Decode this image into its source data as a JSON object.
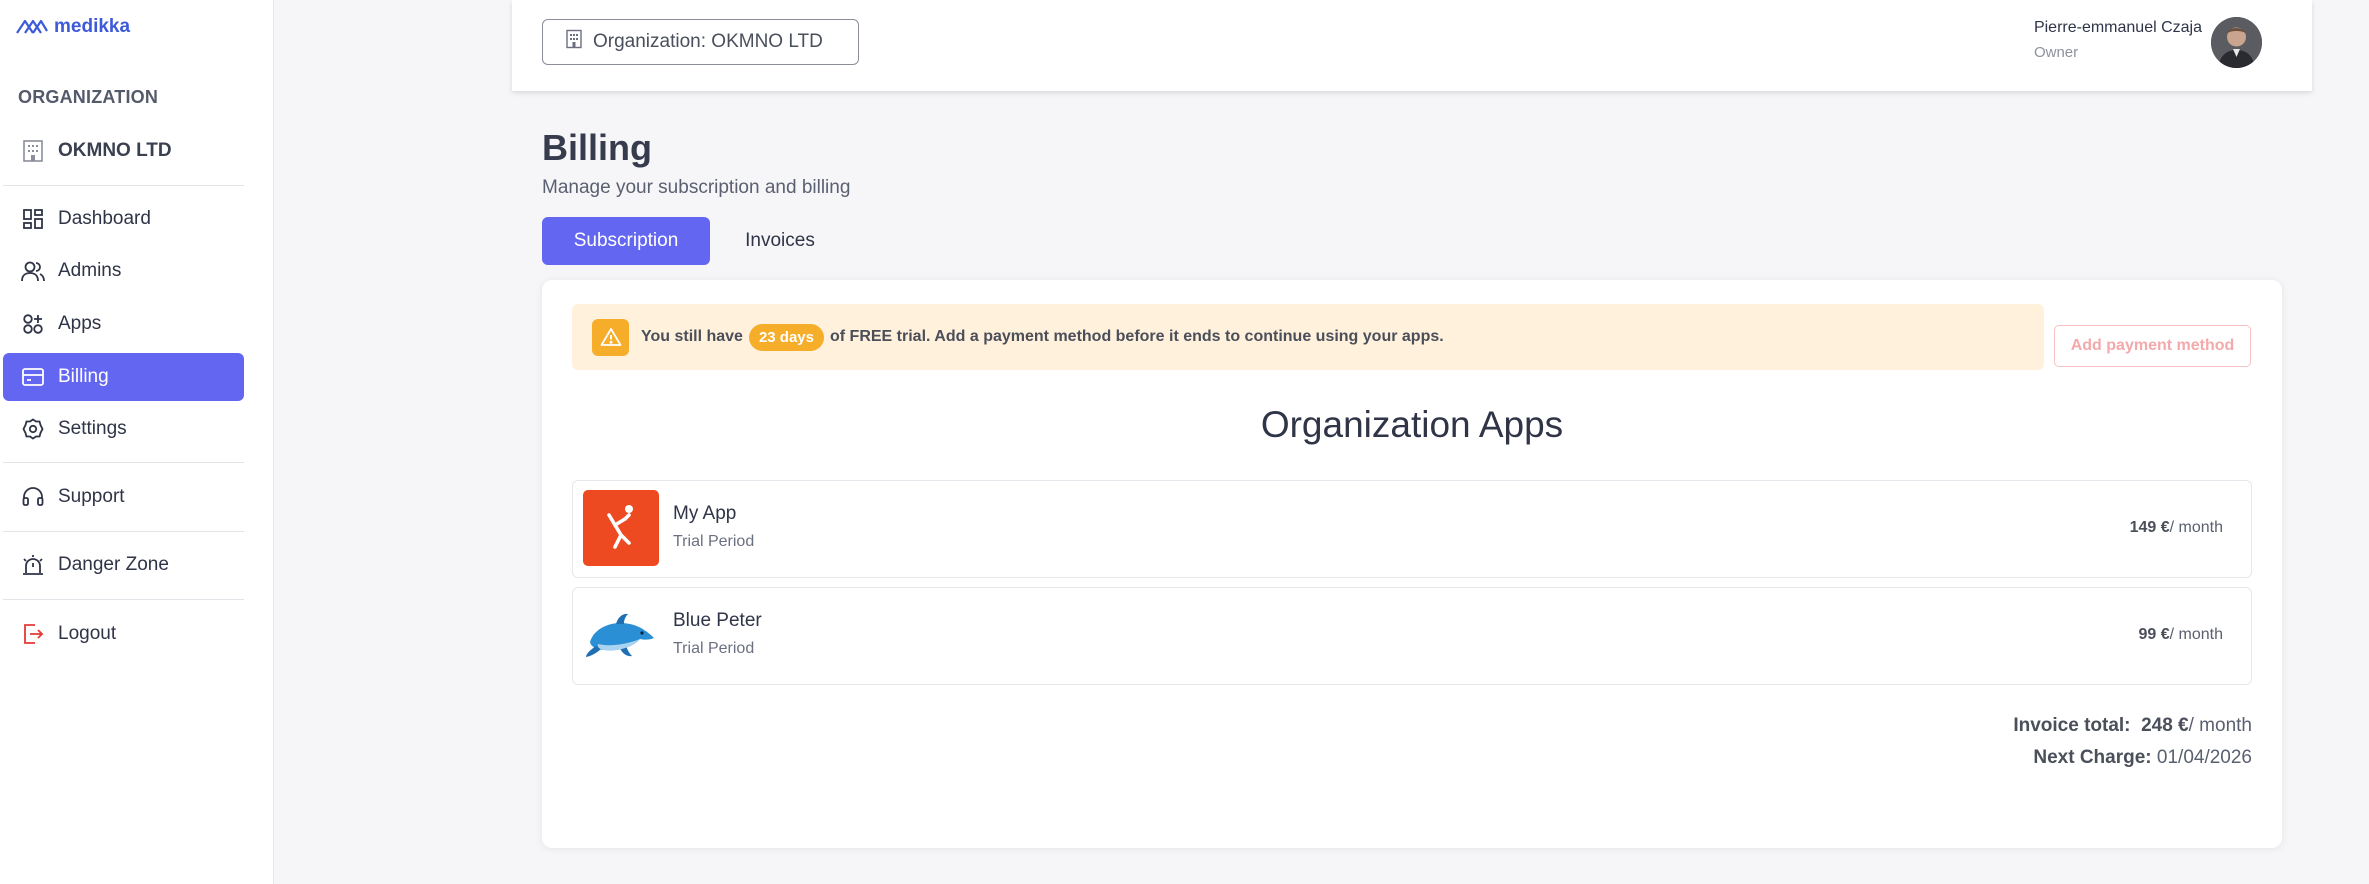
{
  "brand": {
    "name": "medikka",
    "color": "#3d5bd9"
  },
  "sidebar": {
    "section_heading": "ORGANIZATION",
    "org_name": "OKMNO LTD",
    "items": [
      {
        "label": "Dashboard",
        "icon": "grid-icon"
      },
      {
        "label": "Admins",
        "icon": "users-icon"
      },
      {
        "label": "Apps",
        "icon": "apps-plus-icon"
      },
      {
        "label": "Billing",
        "icon": "billing-icon",
        "active": true
      },
      {
        "label": "Settings",
        "icon": "gear-icon"
      }
    ],
    "support": "Support",
    "danger": "Danger Zone",
    "logout": "Logout"
  },
  "topbar": {
    "org_button": "Organization: OKMNO LTD",
    "user_name": "Pierre-emmanuel Czaja",
    "user_role": "Owner"
  },
  "page": {
    "title": "Billing",
    "subtitle": "Manage your subscription and billing",
    "tabs": [
      "Subscription",
      "Invoices"
    ]
  },
  "trial_banner": {
    "prefix": "You still have",
    "days": "23 days",
    "suffix": "of FREE trial. Add a payment method before it ends to continue using your apps.",
    "button": "Add payment method"
  },
  "apps": {
    "title": "Organization Apps",
    "items": [
      {
        "name": "My App",
        "status": "Trial Period",
        "price": "149 €",
        "period": "/ month",
        "icon": "volleyball-player-icon"
      },
      {
        "name": "Blue Peter",
        "status": "Trial Period",
        "price": "99 €",
        "period": "/ month",
        "icon": "dolphin-icon"
      }
    ]
  },
  "summary": {
    "total_label": "Invoice total:",
    "total_value": "248 €",
    "total_period": "/ month",
    "next_label": "Next Charge:",
    "next_value": "01/04/2026"
  },
  "colors": {
    "accent": "#6366f1",
    "warning": "#f5ad2a",
    "banner_bg": "#fff1dc",
    "logout_icon": "#e53935"
  }
}
